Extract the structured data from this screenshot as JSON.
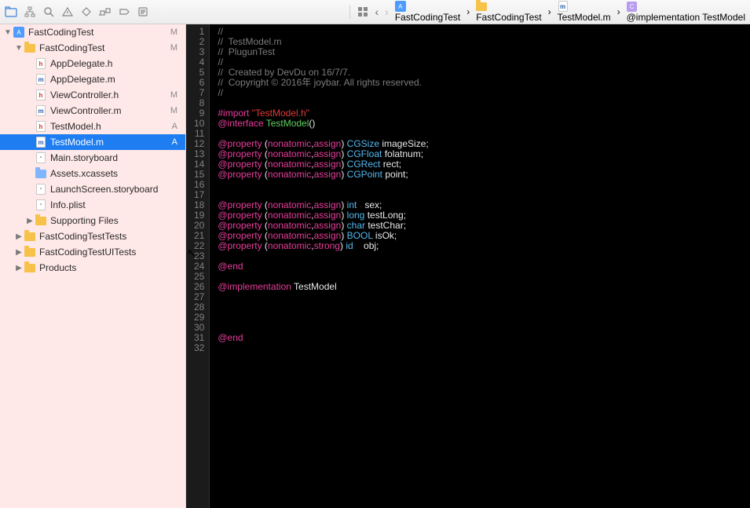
{
  "toolbar_icons": [
    "folder-icon",
    "hierarchy-icon",
    "search-icon",
    "warning-icon",
    "diamond-icon",
    "debug-icon",
    "breakpoint-icon",
    "log-icon"
  ],
  "sidebar": {
    "root": {
      "label": "FastCodingTest",
      "status": "M"
    },
    "group": {
      "label": "FastCodingTest",
      "status": "M"
    },
    "files": [
      {
        "label": "AppDelegate.h",
        "ext": "h",
        "status": ""
      },
      {
        "label": "AppDelegate.m",
        "ext": "m",
        "status": ""
      },
      {
        "label": "ViewController.h",
        "ext": "h",
        "status": "M"
      },
      {
        "label": "ViewController.m",
        "ext": "m",
        "status": "M"
      },
      {
        "label": "TestModel.h",
        "ext": "h",
        "status": "A"
      },
      {
        "label": "TestModel.m",
        "ext": "m",
        "status": "A",
        "selected": true
      },
      {
        "label": "Main.storyboard",
        "ext": "sb",
        "status": ""
      },
      {
        "label": "Assets.xcassets",
        "ext": "folder-blue",
        "status": ""
      },
      {
        "label": "LaunchScreen.storyboard",
        "ext": "sb",
        "status": ""
      },
      {
        "label": "Info.plist",
        "ext": "plist",
        "status": ""
      },
      {
        "label": "Supporting Files",
        "ext": "folder",
        "status": "",
        "disclosure": true
      }
    ],
    "siblings": [
      {
        "label": "FastCodingTestTests"
      },
      {
        "label": "FastCodingTestUITests"
      },
      {
        "label": "Products"
      }
    ]
  },
  "breadcrumb": [
    {
      "label": "FastCodingTest",
      "icon": "proj"
    },
    {
      "label": "FastCodingTest",
      "icon": "folder"
    },
    {
      "label": "TestModel.m",
      "icon": "m"
    },
    {
      "label": "@implementation TestModel",
      "icon": "c"
    }
  ],
  "code": {
    "lines": [
      {
        "t": "comment",
        "s": "//"
      },
      {
        "t": "comment",
        "s": "//  TestModel.m"
      },
      {
        "t": "comment",
        "s": "//  PlugunTest"
      },
      {
        "t": "comment",
        "s": "//"
      },
      {
        "t": "comment",
        "s": "//  Created by DevDu on 16/7/7."
      },
      {
        "t": "comment",
        "s": "//  Copyright © 2016年 joybar. All rights reserved."
      },
      {
        "t": "comment",
        "s": "//"
      },
      {
        "t": "blank",
        "s": ""
      },
      {
        "t": "import",
        "pre": "#import ",
        "str": "\"TestModel.h\""
      },
      {
        "t": "interface",
        "kw": "@interface ",
        "cls": "TestModel",
        "tail": "()"
      },
      {
        "t": "blank",
        "s": ""
      },
      {
        "t": "prop",
        "type": "CGSize",
        "name": "imageSize",
        "attr": "assign"
      },
      {
        "t": "prop",
        "type": "CGFloat",
        "name": "folatnum",
        "attr": "assign"
      },
      {
        "t": "prop",
        "type": "CGRect",
        "name": "rect",
        "attr": "assign"
      },
      {
        "t": "prop",
        "type": "CGPoint",
        "name": "point",
        "attr": "assign"
      },
      {
        "t": "blank",
        "s": ""
      },
      {
        "t": "blank",
        "s": ""
      },
      {
        "t": "prop",
        "type": "int",
        "name": "sex",
        "pad": "  ",
        "attr": "assign"
      },
      {
        "t": "prop",
        "type": "long",
        "name": "testLong",
        "attr": "assign"
      },
      {
        "t": "prop",
        "type": "char",
        "name": "testChar",
        "attr": "assign"
      },
      {
        "t": "prop",
        "type": "BOOL",
        "name": "isOk",
        "attr": "assign"
      },
      {
        "t": "prop",
        "type": "id",
        "name": "obj",
        "pad": "   ",
        "attr": "strong"
      },
      {
        "t": "blank",
        "s": ""
      },
      {
        "t": "end",
        "s": "@end"
      },
      {
        "t": "blank",
        "s": ""
      },
      {
        "t": "impl",
        "kw": "@implementation ",
        "cls": "TestModel"
      },
      {
        "t": "blank",
        "s": ""
      },
      {
        "t": "blank",
        "s": ""
      },
      {
        "t": "blank",
        "s": ""
      },
      {
        "t": "blank",
        "s": ""
      },
      {
        "t": "end",
        "s": "@end"
      },
      {
        "t": "blank",
        "s": ""
      }
    ]
  }
}
